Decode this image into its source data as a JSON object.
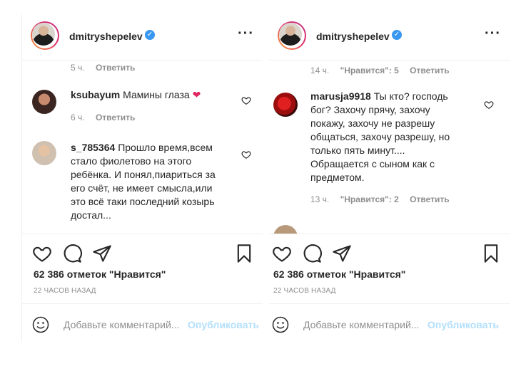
{
  "left_panel": {
    "username": "dmitryshepelev",
    "top_meta": {
      "time": "5 ч.",
      "reply": "Ответить"
    },
    "comments": [
      {
        "user": "ksubayum",
        "text": "Мамины глаза",
        "emoji": "❤",
        "time": "6 ч.",
        "reply": "Ответить"
      },
      {
        "user": "s_785364",
        "text": "Прошло время,всем стало фиолетово на этого ребёнка. И понял,пиариться за его счёт, не имеет смысла,или это всё таки последний козырь достал..."
      }
    ],
    "likes": "62 386 отметок \"Нравится\"",
    "time_ago": "22 ЧАСОВ НАЗАД",
    "add_comment_placeholder": "Добавьте комментарий...",
    "publish": "Опубликовать"
  },
  "right_panel": {
    "username": "dmitryshepelev",
    "top_meta": {
      "time": "14 ч.",
      "likes": "\"Нравится\": 5",
      "reply": "Ответить"
    },
    "comments": [
      {
        "user": "marusja9918",
        "text": "Ты кто? господь бог? Захочу прячу, захочу покажу, захочу не разрешу общаться, захочу разрешу, но только пять минут.... Обращается с сыном как с предметом.",
        "time": "13 ч.",
        "likes": "\"Нравится\": 2",
        "reply": "Ответить"
      }
    ],
    "likes": "62 386 отметок \"Нравится\"",
    "time_ago": "22 ЧАСОВ НАЗАД",
    "add_comment_placeholder": "Добавьте комментарий...",
    "publish": "Опубликовать"
  },
  "icons": {
    "verified": "verified-badge-icon",
    "more": "more-options-icon",
    "heart": "heart-icon",
    "comment": "comment-icon",
    "share": "share-icon",
    "save": "bookmark-icon",
    "emoji": "emoji-icon"
  },
  "colors": {
    "verified": "#3897f0",
    "publish_disabled": "#b2dffc",
    "heart_emoji": "#e0245e"
  }
}
